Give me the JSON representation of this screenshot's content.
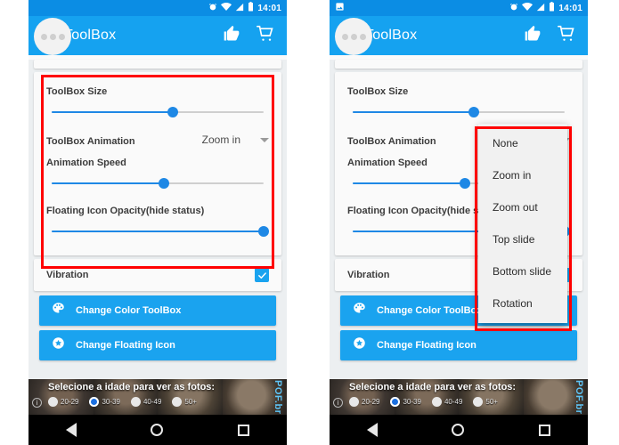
{
  "app": {
    "title": "ToolBox",
    "logo_icon": "three-dots-circle-icon",
    "thumbs_up_icon": "thumbs-up-icon",
    "cart_icon": "shopping-cart-icon",
    "accent_blue": "#15a2f0",
    "statusbar_blue": "#0b8de4",
    "annotation_color": "#ff0000"
  },
  "statusbar": {
    "time": "14:01",
    "alarm_icon": "alarm-clock-icon",
    "wifi_icon": "wifi-icon",
    "signal_icon": "signal-bars-icon",
    "battery_icon": "battery-icon",
    "screenshot_icon": "image-screenshot-icon"
  },
  "settings": {
    "toolbox_size": {
      "label": "ToolBox Size",
      "value_pct": 57
    },
    "toolbox_animation": {
      "label": "ToolBox Animation",
      "value": "Zoom in",
      "caret_icon": "chevron-down-icon"
    },
    "animation_speed": {
      "label": "Animation Speed",
      "value_pct": 53
    },
    "floating_icon_opacity": {
      "label": "Floating Icon Opacity(hide status)",
      "value_pct": 100
    },
    "vibration": {
      "label": "Vibration",
      "checked": true,
      "check_icon": "checkmark-icon"
    },
    "change_color": {
      "label": "Change Color ToolBox",
      "icon": "palette-icon"
    },
    "change_floating_icon": {
      "label": "Change Floating Icon",
      "icon": "star-circle-icon"
    }
  },
  "animation_menu": {
    "items": [
      {
        "label": "None"
      },
      {
        "label": "Zoom in"
      },
      {
        "label": "Zoom out"
      },
      {
        "label": "Top slide"
      },
      {
        "label": "Bottom slide"
      },
      {
        "label": "Rotation"
      }
    ]
  },
  "ad": {
    "headline": "Selecione a idade para ver as fotos:",
    "brand": "POF.br",
    "info_icon": "info-icon",
    "options": [
      {
        "label": "20-29",
        "selected": false
      },
      {
        "label": "30-39",
        "selected": true
      },
      {
        "label": "40-49",
        "selected": false
      },
      {
        "label": "50+",
        "selected": false
      }
    ]
  },
  "navbar": {
    "back_icon": "back-triangle-icon",
    "home_icon": "home-circle-icon",
    "recents_icon": "recents-square-icon"
  }
}
